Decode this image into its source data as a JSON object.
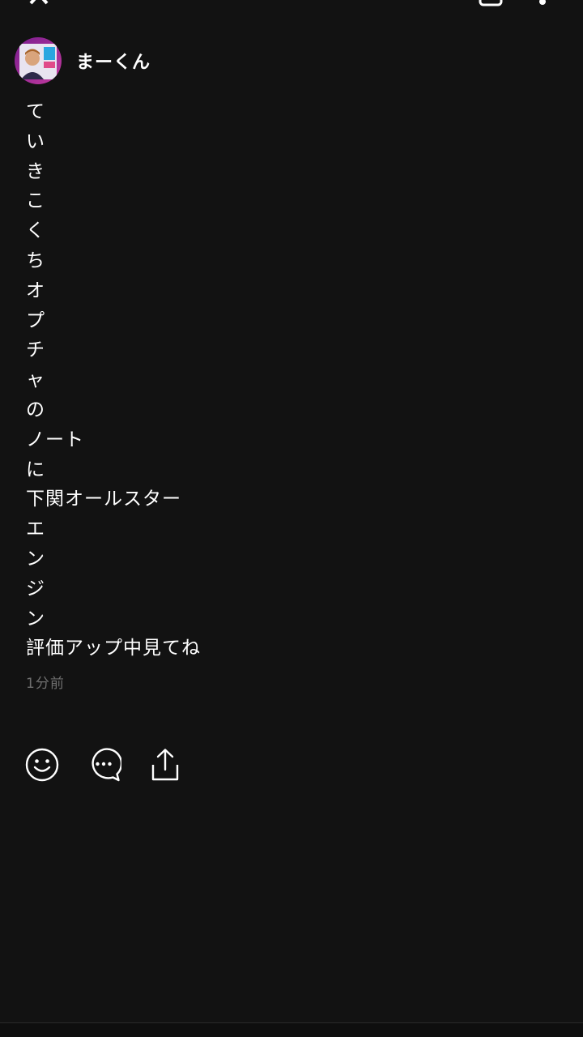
{
  "top_bar": {
    "title": "",
    "back_icon": "chevron-left-icon",
    "icons": [
      "clipboard-icon",
      "more-vertical-icon"
    ]
  },
  "post": {
    "author": {
      "name": "まーくん",
      "avatar_icon": "avatar"
    },
    "lines": [
      "て",
      "い",
      "き",
      "こ",
      "く",
      "ち",
      "オ",
      "プ",
      "チ",
      "ャ",
      "の",
      "ノート",
      "に",
      "下関オールスター",
      "エ",
      "ン",
      "ジ",
      "ン",
      "評価アップ中見てね"
    ],
    "timestamp": "1分前"
  },
  "actions": {
    "reaction_icon": "smiley-icon",
    "comment_icon": "chat-bubble-icon",
    "share_icon": "share-icon"
  },
  "colors": {
    "background": "#121212",
    "text": "#ffffff",
    "muted": "#6f6f6f"
  }
}
